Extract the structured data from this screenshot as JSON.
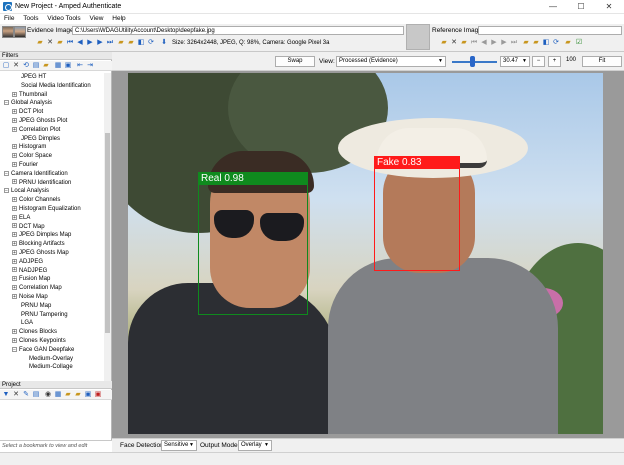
{
  "window": {
    "title": "New Project - Amped Authenticate",
    "minimize": "—",
    "maximize": "☐",
    "close": "✕"
  },
  "menu": [
    "File",
    "Tools",
    "Video Tools",
    "View",
    "Help"
  ],
  "evidence": {
    "label": "Evidence Image:",
    "path": "C:\\Users\\WDAGUtilityAccount\\Desktop\\deepfake.jpg",
    "info": "Size: 3264x2448, JPEG, Q: 98%, Camera: Google Pixel 3a"
  },
  "reference": {
    "label": "Reference Image:"
  },
  "filters": {
    "header": "Filters",
    "tree": [
      {
        "label": "JPEG HT",
        "level": 1,
        "expand": ""
      },
      {
        "label": "Social Media Identification",
        "level": 1,
        "expand": ""
      },
      {
        "label": "Thumbnail",
        "level": 1,
        "expand": "+"
      },
      {
        "label": "Global Analysis",
        "level": 0,
        "expand": "−"
      },
      {
        "label": "DCT Plot",
        "level": 1,
        "expand": "+"
      },
      {
        "label": "JPEG Ghosts Plot",
        "level": 1,
        "expand": "+"
      },
      {
        "label": "Correlation Plot",
        "level": 1,
        "expand": "+"
      },
      {
        "label": "JPEG Dimples",
        "level": 1,
        "expand": ""
      },
      {
        "label": "Histogram",
        "level": 1,
        "expand": "+"
      },
      {
        "label": "Color Space",
        "level": 1,
        "expand": "+"
      },
      {
        "label": "Fourier",
        "level": 1,
        "expand": "+"
      },
      {
        "label": "Camera Identification",
        "level": 0,
        "expand": "−"
      },
      {
        "label": "PRNU Identification",
        "level": 1,
        "expand": "+"
      },
      {
        "label": "Local Analysis",
        "level": 0,
        "expand": "−"
      },
      {
        "label": "Color Channels",
        "level": 1,
        "expand": "+"
      },
      {
        "label": "Histogram Equalization",
        "level": 1,
        "expand": "+"
      },
      {
        "label": "ELA",
        "level": 1,
        "expand": "+"
      },
      {
        "label": "DCT Map",
        "level": 1,
        "expand": "+"
      },
      {
        "label": "JPEG Dimples Map",
        "level": 1,
        "expand": "+"
      },
      {
        "label": "Blocking Artifacts",
        "level": 1,
        "expand": "+"
      },
      {
        "label": "JPEG Ghosts Map",
        "level": 1,
        "expand": "+"
      },
      {
        "label": "ADJPEG",
        "level": 1,
        "expand": "+"
      },
      {
        "label": "NADJPEG",
        "level": 1,
        "expand": "+"
      },
      {
        "label": "Fusion Map",
        "level": 1,
        "expand": "+"
      },
      {
        "label": "Correlation Map",
        "level": 1,
        "expand": "+"
      },
      {
        "label": "Noise Map",
        "level": 1,
        "expand": "+"
      },
      {
        "label": "PRNU Map",
        "level": 1,
        "expand": ""
      },
      {
        "label": "PRNU Tampering",
        "level": 1,
        "expand": ""
      },
      {
        "label": "LGA",
        "level": 1,
        "expand": ""
      },
      {
        "label": "Clones Blocks",
        "level": 1,
        "expand": "+"
      },
      {
        "label": "Clones Keypoints",
        "level": 1,
        "expand": "+"
      },
      {
        "label": "Face GAN Deepfake",
        "level": 1,
        "expand": "−"
      },
      {
        "label": "Medium-Overlay",
        "level": 2,
        "expand": ""
      },
      {
        "label": "Medium-Collage",
        "level": 2,
        "expand": ""
      }
    ]
  },
  "project": {
    "header": "Project"
  },
  "status_left": "Select a bookmark to view and edit",
  "viewer": {
    "swap": "Swap",
    "view_label": "View:",
    "view_value": "Processed (Evidence)",
    "zoom_value": "30.47",
    "zoom_minus": "−",
    "zoom_plus": "+",
    "zoom_100": "100",
    "fit": "Fit"
  },
  "detections": [
    {
      "label": "Real 0.98",
      "color": "#0f8a1e"
    },
    {
      "label": "Fake 0.83",
      "color": "#ff1a1a"
    }
  ],
  "bottom": {
    "face_detection_label": "Face Detection:",
    "face_detection_value": "Sensitive",
    "output_mode_label": "Output Mode:",
    "output_mode_value": "Overlay"
  }
}
